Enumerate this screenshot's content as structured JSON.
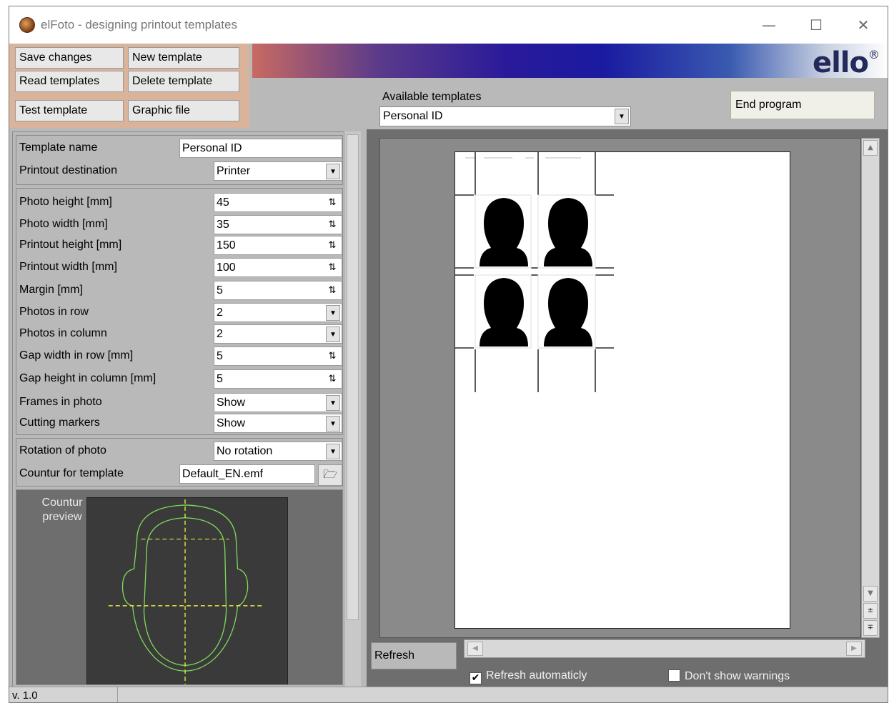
{
  "window": {
    "title": "elFoto - designing printout templates",
    "minimize_glyph": "—",
    "maximize_glyph": "☐",
    "close_glyph": "✕"
  },
  "toolbar": {
    "save_changes": "Save changes",
    "new_template": "New template",
    "read_templates": "Read templates",
    "delete_template": "Delete template",
    "test_template": "Test template",
    "graphic_file": "Graphic file",
    "end_program": "End program",
    "available_templates_label": "Available templates",
    "available_templates_value": "Personal ID",
    "logo_text": "ello",
    "logo_mark": "®"
  },
  "form": {
    "template_name": {
      "label": "Template name",
      "value": "Personal ID"
    },
    "printout_destination": {
      "label": "Printout destination",
      "value": "Printer"
    },
    "photo_height": {
      "label": "Photo height [mm]",
      "value": "45"
    },
    "photo_width": {
      "label": "Photo width [mm]",
      "value": "35"
    },
    "printout_height": {
      "label": "Printout height [mm]",
      "value": "150"
    },
    "printout_width": {
      "label": "Printout width [mm]",
      "value": "100"
    },
    "margin": {
      "label": "Margin [mm]",
      "value": "5"
    },
    "photos_in_row": {
      "label": "Photos in row",
      "value": "2"
    },
    "photos_in_column": {
      "label": "Photos in column",
      "value": "2"
    },
    "gap_width_in_row": {
      "label": "Gap width in row [mm]",
      "value": "5"
    },
    "gap_height_in_column": {
      "label": "Gap height in column [mm]",
      "value": "5"
    },
    "frames_in_photo": {
      "label": "Frames in photo",
      "value": "Show"
    },
    "cutting_markers": {
      "label": "Cutting markers",
      "value": "Show"
    },
    "rotation_of_photo": {
      "label": "Rotation of photo",
      "value": "No rotation"
    },
    "countur_for_template": {
      "label": "Countur for template",
      "value": "Default_EN.emf"
    }
  },
  "preview": {
    "label_line1": "Countur",
    "label_line2": "preview"
  },
  "right": {
    "refresh": "Refresh",
    "refresh_automatically": "Refresh automaticly",
    "refresh_automatically_checked": true,
    "dont_show_warnings": "Don't show warnings",
    "dont_show_warnings_checked": false
  },
  "status": {
    "version": "v. 1.0"
  },
  "colors": {
    "panel_bg": "#b9b9b9",
    "button_group_bg": "#d9b39a",
    "workspace_bg": "#6e6e6e",
    "contour_line": "#7fdc5a",
    "crosshair": "#e6e640",
    "logo": "#23295a"
  }
}
